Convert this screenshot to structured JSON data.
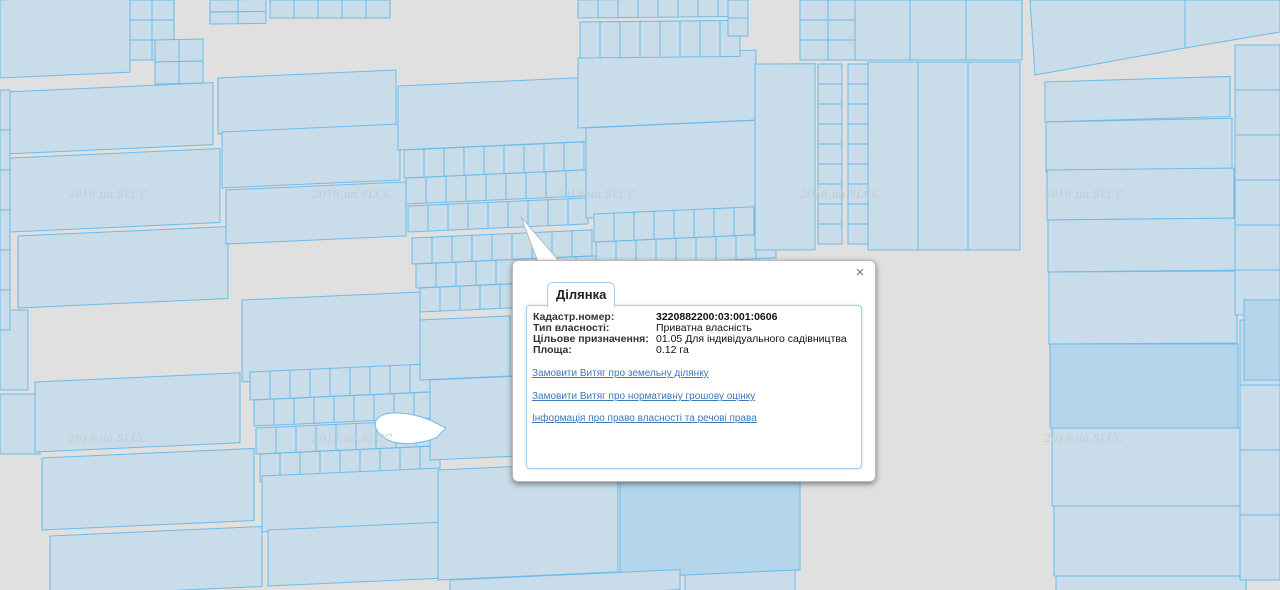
{
  "map": {
    "watermark": "2018.ua.SLCC",
    "colors": {
      "background": "#e0e0e0",
      "parcel_fill": "#c8dce9",
      "parcel_stroke": "#6cbbea",
      "highlight_fill": "#b3d6ed"
    }
  },
  "popup": {
    "tab_label": "Ділянка",
    "close_symbol": "×",
    "fields": [
      {
        "label": "Кадастр.номер:",
        "value": "3220882200:03:001:0606",
        "bold": true
      },
      {
        "label": "Тип власності:",
        "value": "Приватна власність",
        "bold": false
      },
      {
        "label": "Цільове призначення:",
        "value": "01.05 Для індивідуального садівництва",
        "bold": false
      },
      {
        "label": "Площа:",
        "value": "0.12 га",
        "bold": false
      }
    ],
    "links": [
      "Замовити Витяг про земельну ділянку",
      "Замовити Витяг про нормативну грошову оцінку",
      "Інформація про право власності та речові права"
    ]
  }
}
